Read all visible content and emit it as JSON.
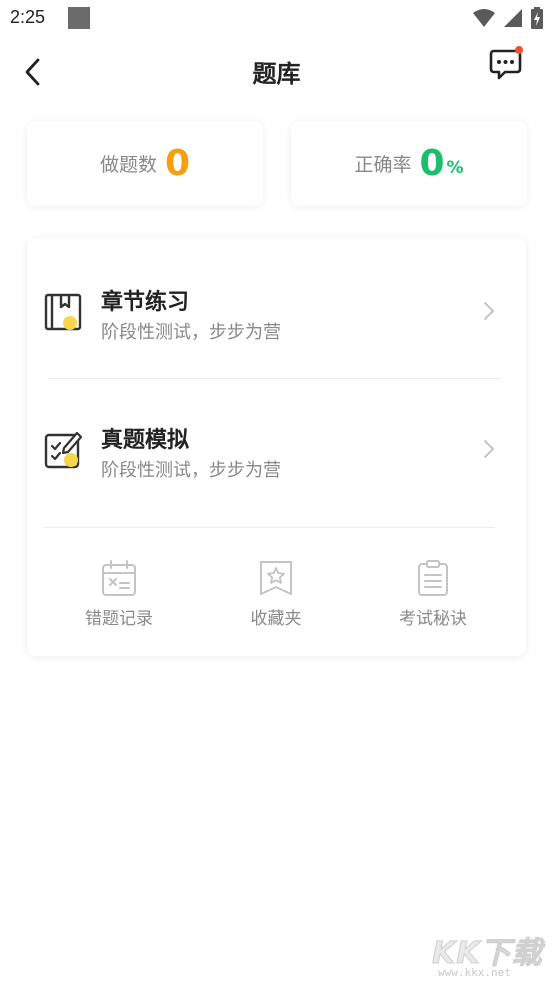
{
  "status_bar": {
    "time": "2:25",
    "icons": [
      "wifi-icon",
      "signal-icon",
      "battery-icon"
    ]
  },
  "header": {
    "title": "题库",
    "back_icon": "chevron-left-icon",
    "message_icon": "chat-bubble-icon",
    "has_notification_dot": true
  },
  "stats": {
    "done": {
      "label": "做题数",
      "value": "0"
    },
    "accuracy": {
      "label": "正确率",
      "value": "0",
      "unit": "%"
    }
  },
  "practice": [
    {
      "title": "章节练习",
      "subtitle": "阶段性测试，步步为营",
      "icon": "book-icon"
    },
    {
      "title": "真题模拟",
      "subtitle": "阶段性测试，步步为营",
      "icon": "checklist-pen-icon"
    }
  ],
  "tools": [
    {
      "label": "错题记录",
      "icon": "calendar-x-icon"
    },
    {
      "label": "收藏夹",
      "icon": "star-bookmark-icon"
    },
    {
      "label": "考试秘诀",
      "icon": "clipboard-icon"
    }
  ],
  "watermark": {
    "text": "KK下载",
    "url": "www.kkx.net"
  },
  "colors": {
    "accent_orange": "#f5a00f",
    "accent_green": "#1bbf6b",
    "icon_yellow": "#f7d64a",
    "notification_red": "#f0502d"
  }
}
